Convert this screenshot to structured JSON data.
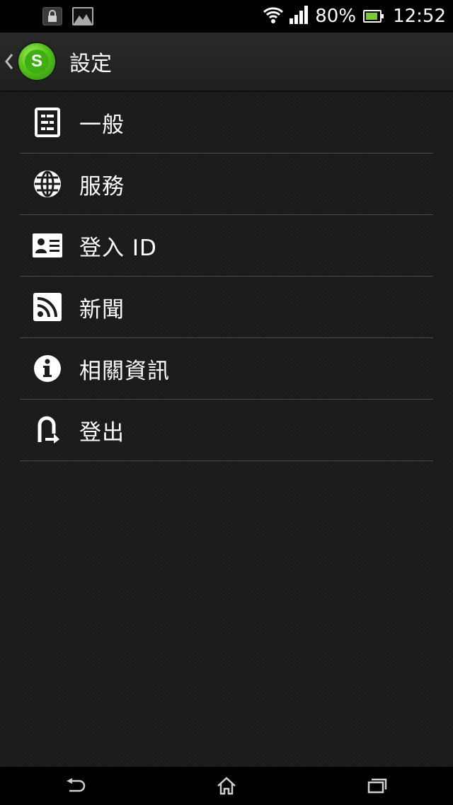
{
  "status_bar": {
    "battery_percent": "80%",
    "battery_level": 0.8,
    "time": "12:52",
    "icons": [
      "lock-icon",
      "image-icon",
      "wifi-icon",
      "signal-icon",
      "battery-icon"
    ]
  },
  "action_bar": {
    "title": "設定",
    "logo_letter": "S",
    "logo_color": "#4cb81a"
  },
  "menu": {
    "items": [
      {
        "label": "一般",
        "icon": "general-settings-icon"
      },
      {
        "label": "服務",
        "icon": "globe-icon"
      },
      {
        "label": "登入 ID",
        "icon": "id-card-icon"
      },
      {
        "label": "新聞",
        "icon": "rss-icon"
      },
      {
        "label": "相關資訊",
        "icon": "info-icon"
      },
      {
        "label": "登出",
        "icon": "logout-icon"
      }
    ]
  },
  "nav_bar": {
    "buttons": [
      "back-icon",
      "home-icon",
      "recent-apps-icon"
    ]
  },
  "colors": {
    "background": "#1b1b1b",
    "divider": "#4a4a4a",
    "text": "#ffffff",
    "battery_fill": "#7cc83c"
  }
}
